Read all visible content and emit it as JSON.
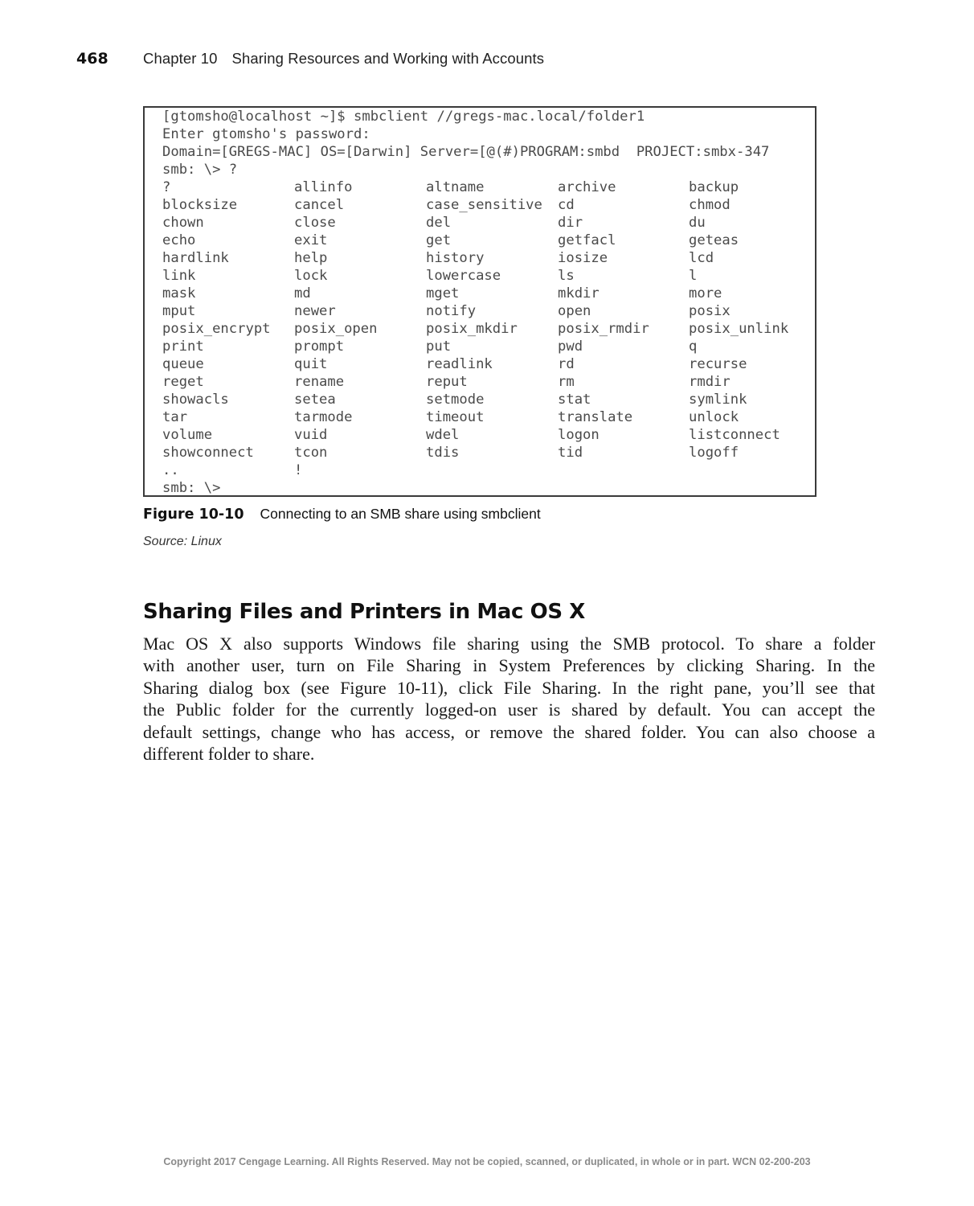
{
  "header": {
    "page_number": "468",
    "chapter": "Chapter 10",
    "chapter_title": "Sharing Resources and Working with Accounts"
  },
  "terminal": {
    "intro_lines": [
      "[gtomsho@localhost ~]$ smbclient //gregs-mac.local/folder1",
      "Enter gtomsho's password:",
      "Domain=[GREGS-MAC] OS=[Darwin] Server=[@(#)PROGRAM:smbd  PROJECT:smbx-347",
      "smb: \\> ?"
    ],
    "command_rows": [
      [
        "?",
        "allinfo",
        "altname",
        "archive",
        "backup"
      ],
      [
        "blocksize",
        "cancel",
        "case_sensitive",
        "cd",
        "chmod"
      ],
      [
        "chown",
        "close",
        "del",
        "dir",
        "du"
      ],
      [
        "echo",
        "exit",
        "get",
        "getfacl",
        "geteas"
      ],
      [
        "hardlink",
        "help",
        "history",
        "iosize",
        "lcd"
      ],
      [
        "link",
        "lock",
        "lowercase",
        "ls",
        "l"
      ],
      [
        "mask",
        "md",
        "mget",
        "mkdir",
        "more"
      ],
      [
        "mput",
        "newer",
        "notify",
        "open",
        "posix"
      ],
      [
        "posix_encrypt",
        "posix_open",
        "posix_mkdir",
        "posix_rmdir",
        "posix_unlink"
      ],
      [
        "print",
        "prompt",
        "put",
        "pwd",
        "q"
      ],
      [
        "queue",
        "quit",
        "readlink",
        "rd",
        "recurse"
      ],
      [
        "reget",
        "rename",
        "reput",
        "rm",
        "rmdir"
      ],
      [
        "showacls",
        "setea",
        "setmode",
        "stat",
        "symlink"
      ],
      [
        "tar",
        "tarmode",
        "timeout",
        "translate",
        "unlock"
      ],
      [
        "volume",
        "vuid",
        "wdel",
        "logon",
        "listconnect"
      ],
      [
        "showconnect",
        "tcon",
        "tdis",
        "tid",
        "logoff"
      ],
      [
        "..",
        "!",
        "",
        "",
        ""
      ]
    ],
    "final_prompt": "smb: \\>"
  },
  "figure": {
    "label": "Figure 10-10",
    "caption": "Connecting to an SMB share using smbclient",
    "source": "Source: Linux"
  },
  "section": {
    "heading": "Sharing Files and Printers in Mac OS X",
    "lines": [
      "Mac OS X also supports Windows file sharing using the SMB protocol. To share a folder",
      "with another user, turn on File Sharing in System Preferences by clicking Sharing. In the",
      "Sharing dialog box (see Figure 10-11), click File Sharing. In the right pane, you’ll see that",
      "the Public folder for the currently logged-on user is shared by default. You can accept the",
      "default settings, change who has access, or remove the shared folder. You can also choose a",
      "different folder to share."
    ]
  },
  "footer": {
    "copyright": "Copyright 2017 Cengage Learning. All Rights Reserved. May not be copied, scanned, or duplicated, in whole or in part.  WCN 02-200-203"
  }
}
